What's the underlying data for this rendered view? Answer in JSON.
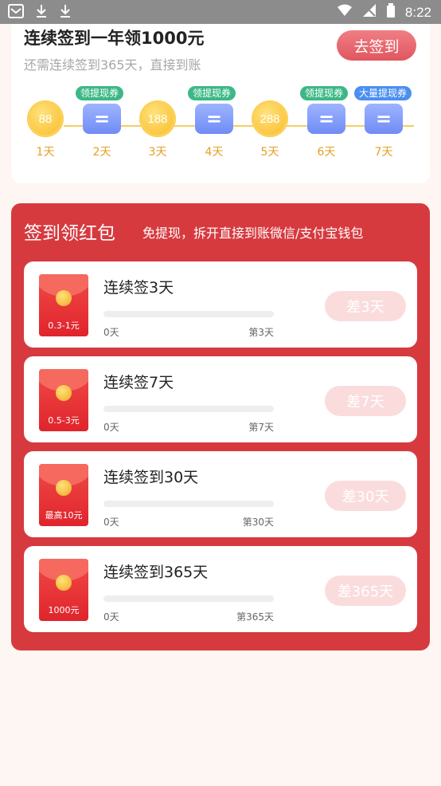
{
  "status": {
    "time": "8:22"
  },
  "header": {
    "title": "连续签到一年领1000元",
    "subtitle": "还需连续签到365天，直接到账",
    "sign_button": "去签到"
  },
  "days": [
    {
      "label": "1天",
      "coin": "88"
    },
    {
      "label": "2天",
      "icon": "coupon-icon",
      "badge": "领提现券"
    },
    {
      "label": "3天",
      "coin": "188"
    },
    {
      "label": "4天",
      "icon": "coupon-icon",
      "badge": "领提现券"
    },
    {
      "label": "5天",
      "coin": "288"
    },
    {
      "label": "6天",
      "icon": "coupon-icon",
      "badge": "领提现券"
    },
    {
      "label": "7天",
      "icon": "coupon-icon",
      "badge": "大量提现券"
    }
  ],
  "panel": {
    "title": "签到领红包",
    "subtitle": "免提现，拆开直接到账微信/支付宝钱包"
  },
  "tasks": [
    {
      "amount": "0.3-1元",
      "name": "连续签3天",
      "start": "0天",
      "end": "第3天",
      "button": "差3天",
      "progress": 0
    },
    {
      "amount": "0.5-3元",
      "name": "连续签7天",
      "start": "0天",
      "end": "第7天",
      "button": "差7天",
      "progress": 0
    },
    {
      "amount": "最高10元",
      "name": "连续签到30天",
      "start": "0天",
      "end": "第30天",
      "button": "差30天",
      "progress": 0
    },
    {
      "amount": "1000元",
      "name": "连续签到365天",
      "start": "0天",
      "end": "第365天",
      "button": "差365天",
      "progress": 0
    }
  ],
  "colors": {
    "accent": "#d63a3f",
    "gold": "#e3a024",
    "button_disabled": "#fbdcdd"
  }
}
